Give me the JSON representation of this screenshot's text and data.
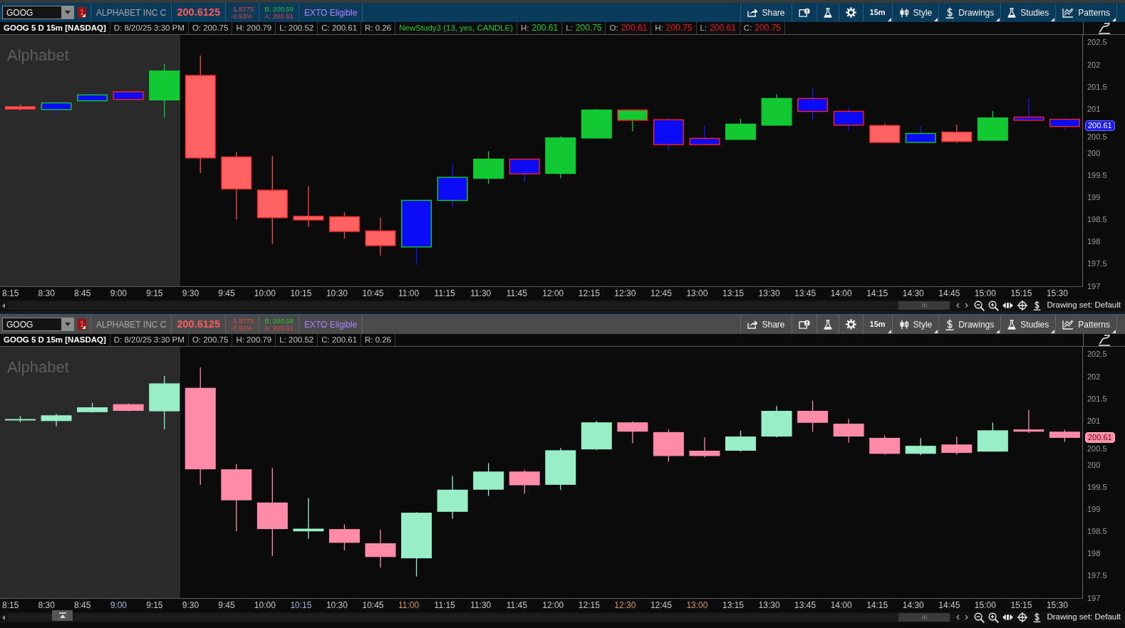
{
  "charts": [
    {
      "active": true,
      "toolbar": {
        "symbol": "GOOG",
        "link_group": "1",
        "company": "ALPHABET INC C",
        "last": "200.6125",
        "net_change": "-1.8775",
        "percent_change": "-0.93%",
        "bid": "B: 200.59",
        "ask": "A: 200.61",
        "exto": "EXTO Eligible",
        "buttons": [
          {
            "kind": "share",
            "label": "Share",
            "has_menu": false
          },
          {
            "kind": "alert",
            "has_menu": false
          },
          {
            "kind": "flask",
            "has_menu": false
          },
          {
            "kind": "gear",
            "has_menu": false
          },
          {
            "kind": "timeframe",
            "label": "15m",
            "has_menu": true
          },
          {
            "kind": "style",
            "label": "Style",
            "has_menu": true
          },
          {
            "kind": "drawings",
            "label": "Drawings",
            "has_menu": true
          },
          {
            "kind": "studies",
            "label": "Studies",
            "has_menu": true
          },
          {
            "kind": "patterns",
            "label": "Patterns",
            "has_menu": true
          }
        ]
      },
      "header": {
        "title": "GOOG 5 D 15m [NASDAQ]",
        "cells": [
          "D: 8/20/25 3:30 PM",
          "O: 200.75",
          "H: 200.79",
          "L: 200.52",
          "C: 200.61",
          "R: 0.26"
        ],
        "study": {
          "name": "NewStudy3 (13, yes, CANDLE)",
          "values": [
            {
              "label": "H:",
              "value": "200.61",
              "color": "#22cc22"
            },
            {
              "label": "L:",
              "value": "200.75",
              "color": "#22cc22"
            },
            {
              "label": "O:",
              "value": "200.61",
              "color": "#e02020"
            },
            {
              "label": "H:",
              "value": "200.75",
              "color": "#e02020"
            },
            {
              "label": "L:",
              "value": "200.61",
              "color": "#e02020"
            },
            {
              "label": "C:",
              "value": "200.75",
              "color": "#e02020"
            }
          ]
        }
      },
      "chart_label": "Alphabet",
      "study_coloring": true,
      "price_axis": {
        "ticks": [
          "202.5",
          "202",
          "201.5",
          "201",
          "200.5",
          "200",
          "199.5",
          "199",
          "198.5",
          "198",
          "197.5",
          "197"
        ],
        "last_price": {
          "text": "200.61",
          "color": "#1c1cf0"
        }
      },
      "time_axis": [
        "8:15",
        "8:30",
        "8:45",
        "9:00",
        "9:15",
        "9:30",
        "9:45",
        "10:00",
        "10:15",
        "10:30",
        "10:45",
        "11:00",
        "11:15",
        "11:30",
        "11:45",
        "12:00",
        "12:15",
        "12:30",
        "12:45",
        "13:00",
        "13:15",
        "13:30",
        "13:45",
        "14:00",
        "14:15",
        "14:30",
        "14:45",
        "15:00",
        "15:15",
        "15:30"
      ],
      "footer": {
        "drawing_set": "Drawing set: Default",
        "collapse_tab": false
      }
    },
    {
      "active": false,
      "toolbar": {
        "symbol": "GOOG",
        "link_group": "1",
        "company": "ALPHABET INC C",
        "last": "200.6125",
        "net_change": "-1.8775",
        "percent_change": "-0.93%",
        "bid": "B: 200.59",
        "ask": "A: 200.61",
        "exto": "EXTO Eligible",
        "buttons": [
          {
            "kind": "share",
            "label": "Share",
            "has_menu": false
          },
          {
            "kind": "alert",
            "has_menu": false
          },
          {
            "kind": "flask",
            "has_menu": false
          },
          {
            "kind": "gear",
            "has_menu": false
          },
          {
            "kind": "timeframe",
            "label": "15m",
            "has_menu": true
          },
          {
            "kind": "style",
            "label": "Style",
            "has_menu": true
          },
          {
            "kind": "drawings",
            "label": "Drawings",
            "has_menu": true
          },
          {
            "kind": "studies",
            "label": "Studies",
            "has_menu": true
          },
          {
            "kind": "patterns",
            "label": "Patterns",
            "has_menu": true
          }
        ]
      },
      "header": {
        "title": "GOOG 5 D 15m [NASDAQ]",
        "cells": [
          "D: 8/20/25 3:30 PM",
          "O: 200.75",
          "H: 200.79",
          "L: 200.52",
          "C: 200.61",
          "R: 0.26"
        ]
      },
      "chart_label": "Alphabet",
      "study_coloring": false,
      "price_axis": {
        "ticks": [
          "202.5",
          "202",
          "201.5",
          "201",
          "200.5",
          "200",
          "199.5",
          "199",
          "198.5",
          "198",
          "197.5",
          "197"
        ],
        "last_price": {
          "text": "200.61",
          "color": "#ff8fa8"
        }
      },
      "time_axis": [
        {
          "text": "8:15",
          "color": "#c8c8c8"
        },
        {
          "text": "8:30",
          "color": "#c8c8c8"
        },
        {
          "text": "8:45",
          "color": "#c8c8c8"
        },
        {
          "text": "9:00",
          "color": "#a4b6d8"
        },
        {
          "text": "9:15",
          "color": "#c8c8c8"
        },
        {
          "text": "9:30",
          "color": "#c8c8c8"
        },
        {
          "text": "9:45",
          "color": "#c8c8c8"
        },
        {
          "text": "10:00",
          "color": "#c8c8c8"
        },
        {
          "text": "10:15",
          "color": "#a4b6d8"
        },
        {
          "text": "10:30",
          "color": "#c8c8c8"
        },
        {
          "text": "10:45",
          "color": "#c8c8c8"
        },
        {
          "text": "11:00",
          "color": "#d39c5c"
        },
        {
          "text": "11:15",
          "color": "#c8c8c8"
        },
        {
          "text": "11:30",
          "color": "#c8c8c8"
        },
        {
          "text": "11:45",
          "color": "#c8c8c8"
        },
        {
          "text": "12:00",
          "color": "#c8c8c8"
        },
        {
          "text": "12:15",
          "color": "#c8c8c8"
        },
        {
          "text": "12:30",
          "color": "#d39c5c"
        },
        {
          "text": "12:45",
          "color": "#c8c8c8"
        },
        {
          "text": "13:00",
          "color": "#d39c5c"
        },
        {
          "text": "13:15",
          "color": "#c8c8c8"
        },
        {
          "text": "13:30",
          "color": "#c8c8c8"
        },
        {
          "text": "13:45",
          "color": "#c8c8c8"
        },
        {
          "text": "14:00",
          "color": "#c8c8c8"
        },
        {
          "text": "14:15",
          "color": "#c8c8c8"
        },
        {
          "text": "14:30",
          "color": "#c8c8c8"
        },
        {
          "text": "14:45",
          "color": "#c8c8c8"
        },
        {
          "text": "15:00",
          "color": "#c8c8c8"
        },
        {
          "text": "15:15",
          "color": "#c8c8c8"
        },
        {
          "text": "15:30",
          "color": "#c8c8c8"
        }
      ],
      "footer": {
        "drawing_set": "Drawing set: Default",
        "collapse_tab": true
      }
    }
  ]
}
